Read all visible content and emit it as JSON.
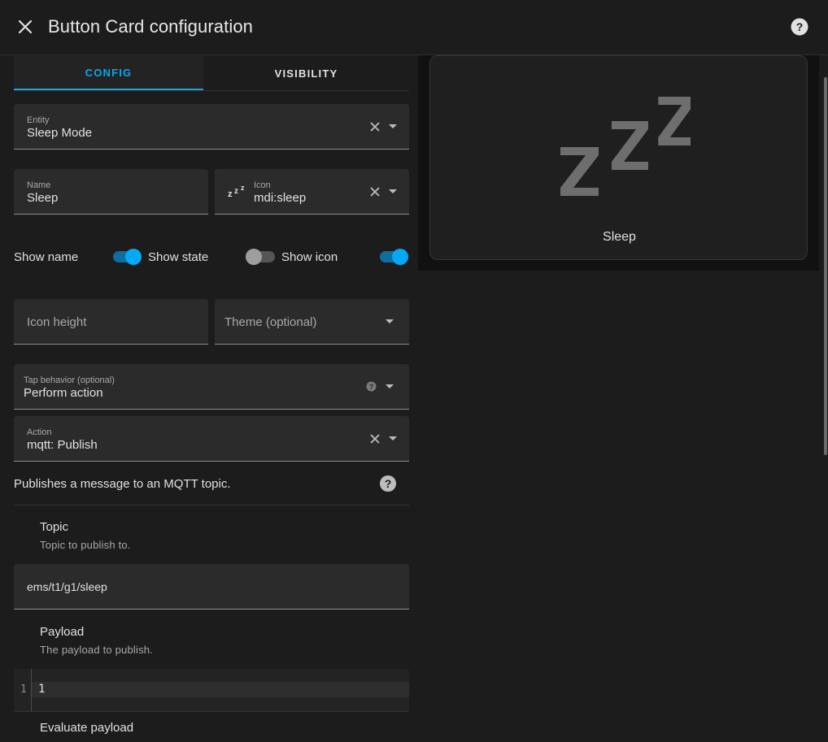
{
  "header": {
    "title": "Button Card configuration"
  },
  "tabs": [
    {
      "label": "CONFIG",
      "active": true
    },
    {
      "label": "VISIBILITY",
      "active": false
    }
  ],
  "entity": {
    "label": "Entity",
    "value": "Sleep Mode"
  },
  "name_field": {
    "label": "Name",
    "value": "Sleep"
  },
  "icon_field": {
    "label": "Icon",
    "value": "mdi:sleep",
    "icon": "sleep-icon"
  },
  "toggles": {
    "show_name": {
      "label": "Show name",
      "on": true
    },
    "show_state": {
      "label": "Show state",
      "on": false
    },
    "show_icon": {
      "label": "Show icon",
      "on": true
    }
  },
  "icon_height": {
    "placeholder": "Icon height"
  },
  "theme": {
    "placeholder": "Theme (optional)"
  },
  "tap_behavior": {
    "label": "Tap behavior (optional)",
    "value": "Perform action"
  },
  "action": {
    "label": "Action",
    "value": "mqtt: Publish"
  },
  "action_description": "Publishes a message to an MQTT topic.",
  "topic": {
    "title": "Topic",
    "description": "Topic to publish to.",
    "value": "ems/t1/g1/sleep"
  },
  "payload": {
    "title": "Payload",
    "description": "The payload to publish.",
    "line_number": "1",
    "value": "1"
  },
  "evaluate_payload": {
    "title": "Evaluate payload"
  },
  "preview": {
    "name": "Sleep",
    "icon": "sleep-icon"
  },
  "colors": {
    "accent": "#03a9f4",
    "background": "#1c1c1c",
    "field": "#2b2b2b",
    "text": "#e1e1e1"
  }
}
